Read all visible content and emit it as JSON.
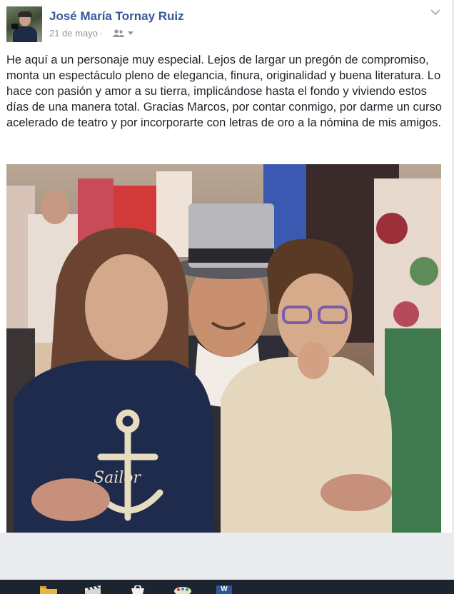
{
  "post": {
    "author": "José María Tornay Ruiz",
    "date": "21 de mayo",
    "separator": "·",
    "audience_icon": "friends-icon",
    "menu_icon": "chevron-down-icon",
    "text": "He aquí a un personaje muy especial. Lejos de largar un pregón de compromiso, monta un espectáculo pleno de elegancia, finura, originalidad y buena literatura. Lo hace con pasión y amor a su tierra, implicándose hasta el fondo y viviendo estos días de una manera total. Gracias Marcos, por contar conmigo, por darme un curso acelerado de teatro y por incorporarte con letras de oro a la nómina de mis amigos.",
    "photo": {
      "sweater_text": "Sailor"
    }
  },
  "taskbar": {
    "icons": [
      "file-explorer-icon",
      "movie-maker-icon",
      "store-icon",
      "paint-icon",
      "word-icon"
    ],
    "word_label": "W"
  },
  "colors": {
    "author_link": "#365899",
    "meta_gray": "#90949c",
    "body_text": "#1d2129",
    "page_bg": "#e9ebee",
    "taskbar_bg": "#1c2430"
  }
}
